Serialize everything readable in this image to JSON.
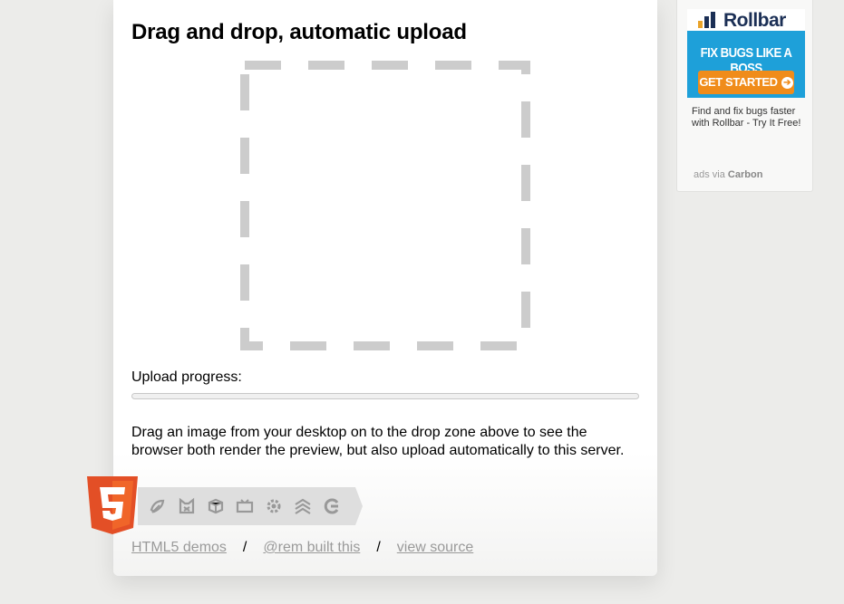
{
  "page": {
    "title": "Drag and drop, automatic upload",
    "progress_label": "Upload progress:",
    "progress_value": 0,
    "description": "Drag an image from your desktop on to the drop zone above to see the browser both render the preview, but also upload automatically to this server."
  },
  "html5_badge": {
    "number": "5",
    "icons": [
      "offline-icon",
      "device-access-icon",
      "3d-effects-icon",
      "multimedia-icon",
      "performance-icon",
      "css3-styling-icon",
      "semantics-icon"
    ],
    "shield_color": "#e34f26"
  },
  "footer": {
    "demos_link": "HTML5 demos",
    "credit_link": "@rem built this",
    "source_link": "view source",
    "separator": "/"
  },
  "ad": {
    "brand": "Rollbar",
    "headline": "FIX BUGS LIKE A BOSS",
    "cta": "GET STARTED",
    "text": "Find and fix bugs faster with Rollbar - Try It Free!",
    "via_prefix": "ads via",
    "via_brand": "Carbon",
    "accent": "#1ea0d9",
    "cta_color": "#f08c1a"
  },
  "colors": {
    "background": "#ececea",
    "dropzone_dash": "#cccccc"
  }
}
